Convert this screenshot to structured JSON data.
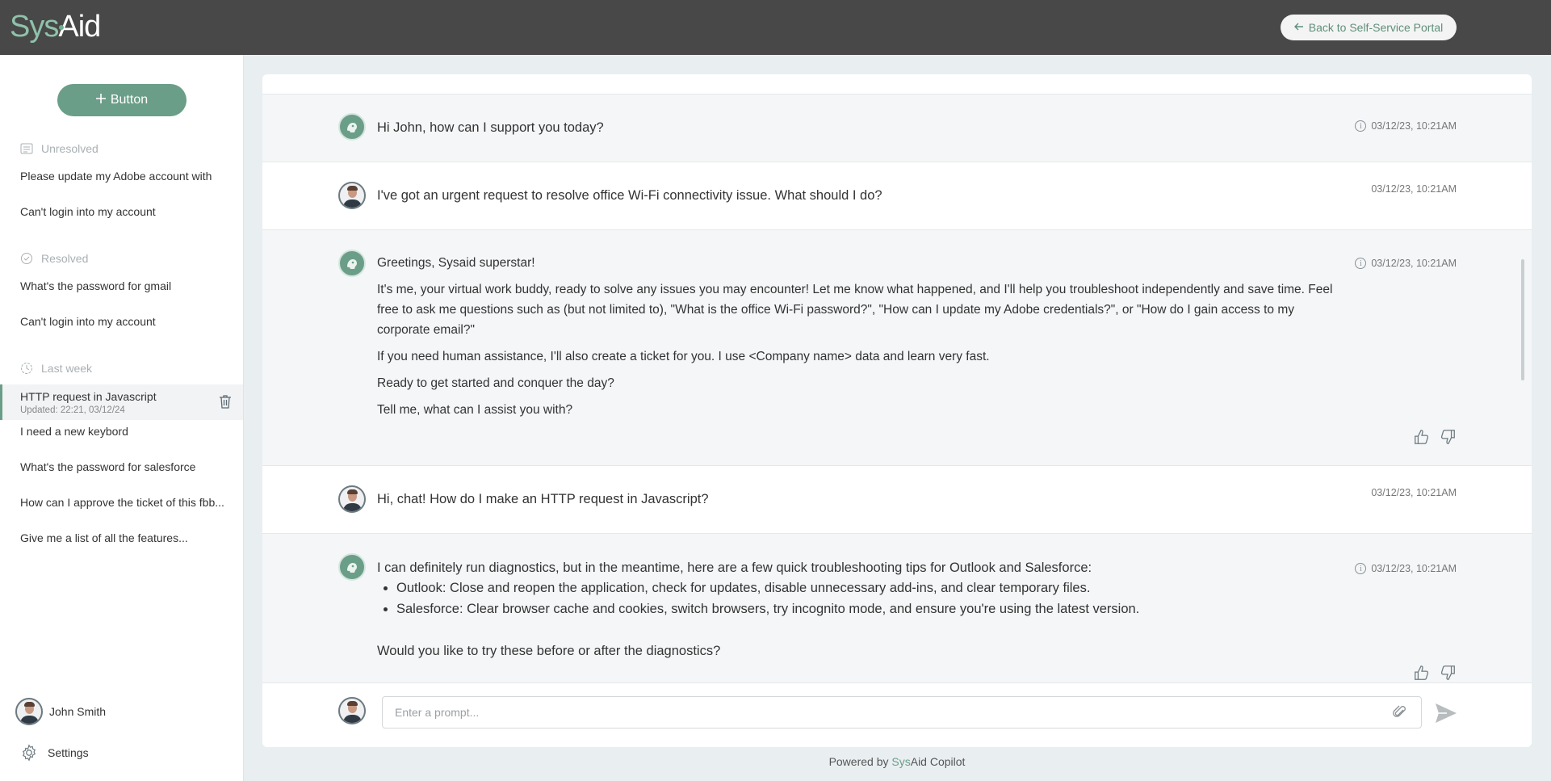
{
  "header": {
    "logo_sys": "Sys",
    "logo_aid": "Aid",
    "back_label": "Back to Self-Service Portal"
  },
  "sidebar": {
    "new_button_label": "Button",
    "sections": {
      "unresolved": {
        "label": "Unresolved",
        "items": [
          "Please update my Adobe account with",
          "Can't login into my account"
        ]
      },
      "resolved": {
        "label": "Resolved",
        "items": [
          "What's the password for gmail",
          "Can't login into my account"
        ]
      },
      "last_week": {
        "label": "Last week",
        "active_item": {
          "title": "HTTP request in Javascript",
          "updated": "Updated: 22:21, 03/12/24"
        },
        "items": [
          "I need a new keybord",
          "What's the password for salesforce",
          "How can I approve the ticket of this fbb...",
          "Give me a list of all the features..."
        ]
      }
    },
    "user_name": "John Smith",
    "settings_label": "Settings"
  },
  "chat": {
    "messages": [
      {
        "text": "Hi John, how can I support you today?",
        "time": "03/12/23, 10:21AM"
      },
      {
        "text": "I've got an urgent request to resolve office Wi-Fi connectivity issue. What should I do?",
        "time": "03/12/23, 10:21AM"
      },
      {
        "time": "03/12/23, 10:21AM",
        "paragraphs": [
          "Greetings, Sysaid superstar!",
          "It's me, your virtual work buddy, ready to solve any issues you may encounter! Let me know what happened, and I'll help you troubleshoot independently and save time. Feel free to ask me questions such as (but not limited to), \"What is the office Wi-Fi password?\", \"How can I update my Adobe credentials?\", or \"How do I gain access to my corporate email?\"",
          "If you need human assistance, I'll also create a ticket for you. I use <Company name> data and learn very fast.",
          "Ready to get started and conquer the day?",
          "Tell me, what can I assist you with?"
        ]
      },
      {
        "text": "Hi, chat! How do I make an HTTP request in Javascript?",
        "time": "03/12/23, 10:21AM"
      },
      {
        "time": "03/12/23, 10:21AM",
        "intro": "I can definitely run diagnostics, but in the meantime, here are a few quick troubleshooting tips for Outlook and Salesforce:",
        "bullets": [
          "Outlook: Close and reopen the application, check for updates, disable unnecessary add-ins, and clear temporary files.",
          "Salesforce: Clear browser cache and cookies, switch browsers, try incognito mode, and ensure you're using the latest version."
        ],
        "outro": "Would you like to try these before or after the diagnostics?"
      }
    ],
    "prompt_placeholder": "Enter a prompt..."
  },
  "footer": {
    "prefix": "Powered by ",
    "sys": "Sys",
    "suffix": "Aid Copilot"
  },
  "colors": {
    "header_bg": "#484848",
    "accent": "#6b9e88",
    "sidebar_bg": "#ffffff",
    "page_bg": "#e9eef1"
  }
}
